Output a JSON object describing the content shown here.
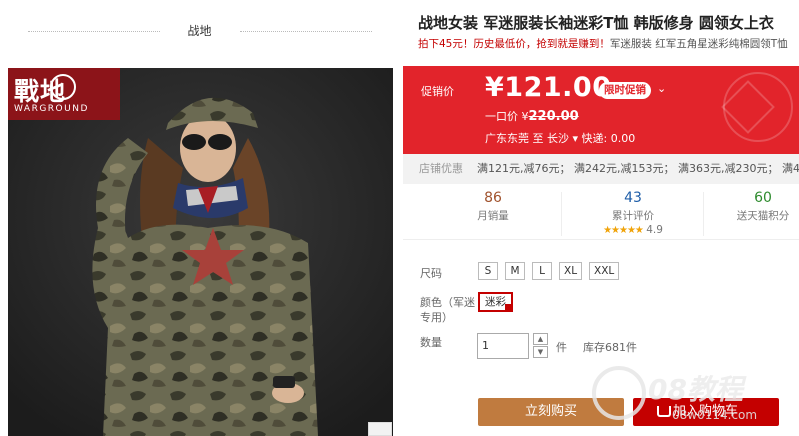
{
  "shop": {
    "name": "战地"
  },
  "image": {
    "brand_cn": "戰地",
    "brand_en": "WARGROUND"
  },
  "product": {
    "title": "战地女装 军迷服装长袖迷彩T恤 韩版修身 圆领女上衣",
    "subtitle_red": "拍下45元！历史最低价，抢到就是赚到！",
    "subtitle_gray": "军迷服装 红军五角星迷彩纯棉圆领T恤"
  },
  "price": {
    "label": "促销价",
    "value": "¥121.00",
    "badge": "限时促销",
    "dropdown_icon": "chevron-down",
    "original_label": "一口价 ¥",
    "original_value": "220.00",
    "shipping": "广东东莞 至  长沙 ▾  快递: 0.00"
  },
  "promo": {
    "label": "店铺优惠",
    "items": "满121元,减76元；  满242元,减153元；  满363元,减230元；  满484元"
  },
  "stats": {
    "monthly_sales": "86",
    "monthly_sales_label": "月销量",
    "reviews": "43",
    "reviews_label": "累计评价",
    "stars": "★★★★★",
    "rating": "4.9",
    "points": "60",
    "points_label": "送天猫积分"
  },
  "options": {
    "size_label": "尺码",
    "sizes": [
      "S",
      "M",
      "L",
      "XL",
      "XXL"
    ],
    "color_label": "颜色（军迷专用）",
    "color_label_line1": "颜色（军迷",
    "color_label_line2": "专用）",
    "color_value": "迷彩",
    "qty_label": "数量",
    "qty_value": "1",
    "unit": "件",
    "stock": "库存681件"
  },
  "actions": {
    "buy_now": "立刻购买",
    "add_cart": "加入购物车"
  },
  "watermark": {
    "text": "08教程",
    "url": "08w0114.com"
  },
  "colors": {
    "accent_red": "#e2242b",
    "buy_brown": "#c07b3f",
    "cart_red": "#c40000"
  }
}
